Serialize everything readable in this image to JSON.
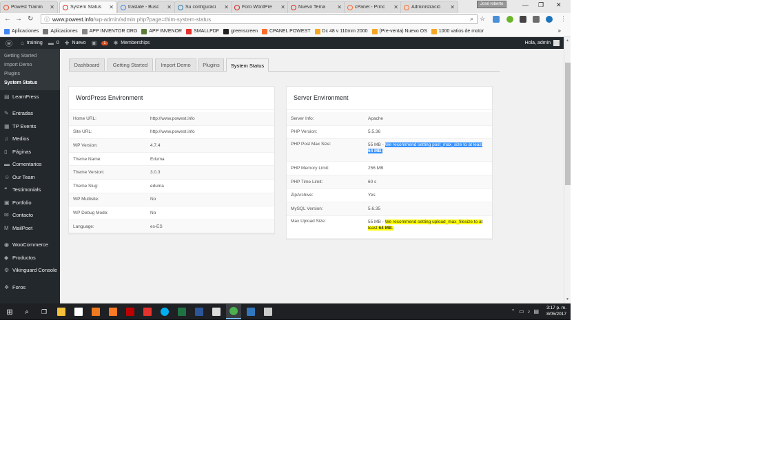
{
  "browser": {
    "tabs": [
      {
        "title": "Powest Trainin",
        "fav_color": "#e44d26"
      },
      {
        "title": "System Status",
        "fav_color": "#d7261e",
        "active": true
      },
      {
        "title": "traslate - Busc",
        "fav_color": "#4285f4"
      },
      {
        "title": "Su configuraci",
        "fav_color": "#2a7ab0"
      },
      {
        "title": "Foro WordPre",
        "fav_color": "#d7261e"
      },
      {
        "title": "Nuevo Tema",
        "fav_color": "#d7261e"
      },
      {
        "title": "cPanel - Princ",
        "fav_color": "#ff6c2c"
      },
      {
        "title": "Administració",
        "fav_color": "#ff6c2c"
      }
    ],
    "profile_label": "José roberto",
    "url_domain": "www.powest.info",
    "url_path": "/wp-admin/admin.php?page=thim-system-status"
  },
  "bookmarks": [
    {
      "label": "Aplicaciones",
      "color": "#4285f4"
    },
    {
      "label": "Aplicaciones",
      "color": "#777777"
    },
    {
      "label": "APP INVENTOR ORG",
      "color": "#888888"
    },
    {
      "label": "APP INVENOR",
      "color": "#5a7d3a"
    },
    {
      "label": "SMALLPDF",
      "color": "#e5322d"
    },
    {
      "label": "greenscreen",
      "color": "#222222"
    },
    {
      "label": "CPANEL POWEST",
      "color": "#ff6c2c"
    },
    {
      "label": "Dc 48 v 110mm 2000",
      "color": "#f5a623"
    },
    {
      "label": "(Pre-venta) Nuevo OS",
      "color": "#f5a623"
    },
    {
      "label": "1000 vatios de motor",
      "color": "#f5a623"
    }
  ],
  "adminbar": {
    "site": "training",
    "comments": "0",
    "new": "Nuevo",
    "updates": "1",
    "memberships": "Memberships",
    "howdy": "Hola, admin"
  },
  "sidebar": {
    "submenu": [
      "Getting Started",
      "Import Demo",
      "Plugins",
      "System Status"
    ],
    "current": "System Status",
    "menu": [
      {
        "label": "LearnPress",
        "icon": "learnpress-icon",
        "glyph": "▤"
      },
      {
        "label": "Entradas",
        "icon": "pin-icon",
        "glyph": "✎",
        "gap": true
      },
      {
        "label": "TP Events",
        "icon": "calendar-icon",
        "glyph": "▦"
      },
      {
        "label": "Medios",
        "icon": "media-icon",
        "glyph": "♫"
      },
      {
        "label": "Páginas",
        "icon": "pages-icon",
        "glyph": "▯"
      },
      {
        "label": "Comentarios",
        "icon": "comments-icon",
        "glyph": "▬"
      },
      {
        "label": "Our Team",
        "icon": "team-icon",
        "glyph": "☺"
      },
      {
        "label": "Testimonials",
        "icon": "testimonials-icon",
        "glyph": "❝"
      },
      {
        "label": "Portfolio",
        "icon": "portfolio-icon",
        "glyph": "▣"
      },
      {
        "label": "Contacto",
        "icon": "mail-icon",
        "glyph": "✉"
      },
      {
        "label": "MailPoet",
        "icon": "mailpoet-icon",
        "glyph": "M"
      },
      {
        "label": "WooCommerce",
        "icon": "woocommerce-icon",
        "glyph": "◉",
        "gap": true
      },
      {
        "label": "Productos",
        "icon": "products-icon",
        "glyph": "◆"
      },
      {
        "label": "Vikinguard Console",
        "icon": "shield-icon",
        "glyph": "⚙"
      },
      {
        "label": "Foros",
        "icon": "forums-icon",
        "glyph": "❖",
        "gap": true
      }
    ]
  },
  "navtabs": [
    "Dashboard",
    "Getting Started",
    "Import Demo",
    "Plugins",
    "System Status"
  ],
  "wp_env": {
    "title": "WordPress Environment",
    "rows": [
      {
        "k": "Home URL:",
        "v": "http://www.powest.info"
      },
      {
        "k": "Site URL:",
        "v": "http://www.powest.info"
      },
      {
        "k": "WP Version:",
        "v": "4.7.4"
      },
      {
        "k": "Theme Name:",
        "v": "Eduma"
      },
      {
        "k": "Theme Version:",
        "v": "3.0.3"
      },
      {
        "k": "Theme Slug:",
        "v": "eduma"
      },
      {
        "k": "WP Multisite:",
        "v": "No"
      },
      {
        "k": "WP Debug Mode:",
        "v": "No"
      },
      {
        "k": "Language:",
        "v": "es-ES"
      }
    ]
  },
  "server_env": {
    "title": "Server Environment",
    "rows": [
      {
        "k": "Server Info:",
        "v": "Apache"
      },
      {
        "k": "PHP Version:",
        "v": "5.5.36"
      },
      {
        "k": "PHP Post Max Size:",
        "v": "55 MB - ",
        "warn_pre": "We recommend setting post_max_size to at least ",
        "warn_strong": "64 MB",
        "warn_post": ".",
        "hl": "blue"
      },
      {
        "k": "PHP Memory Limit:",
        "v": "256 MB"
      },
      {
        "k": "PHP Time Limit:",
        "v": "60 s"
      },
      {
        "k": "ZipArchive:",
        "v": "Yes"
      },
      {
        "k": "MySQL Version:",
        "v": "5.6.35"
      },
      {
        "k": "Max Upload Size:",
        "v": "55 MB - ",
        "warn_pre": "We recommend setting upload_max_filesize to at least ",
        "warn_strong": "64 MB",
        "warn_post": ".",
        "hl": "yellow"
      }
    ]
  },
  "taskbar": {
    "apps": [
      {
        "icon": "file-explorer-icon",
        "color": "#f3c13a"
      },
      {
        "icon": "store-icon",
        "color": "#ffffff"
      },
      {
        "icon": "outlook-icon",
        "color": "#f07a1f"
      },
      {
        "icon": "xampp-icon",
        "color": "#fb7a24"
      },
      {
        "icon": "filezilla-icon",
        "color": "#bf0000"
      },
      {
        "icon": "acrobat-icon",
        "color": "#e5322d"
      },
      {
        "icon": "skype-icon",
        "color": "#00aff0"
      },
      {
        "icon": "excel-icon",
        "color": "#1f7244"
      },
      {
        "icon": "word-icon",
        "color": "#2b579a"
      },
      {
        "icon": "photos-icon",
        "color": "#dddddd"
      },
      {
        "icon": "chrome-icon",
        "color": "#4caf50"
      },
      {
        "icon": "edge-icon",
        "color": "#3277bc"
      },
      {
        "icon": "calculator-icon",
        "color": "#cccccc"
      }
    ],
    "time": "3:17 p. m.",
    "date": "8/05/2017"
  }
}
